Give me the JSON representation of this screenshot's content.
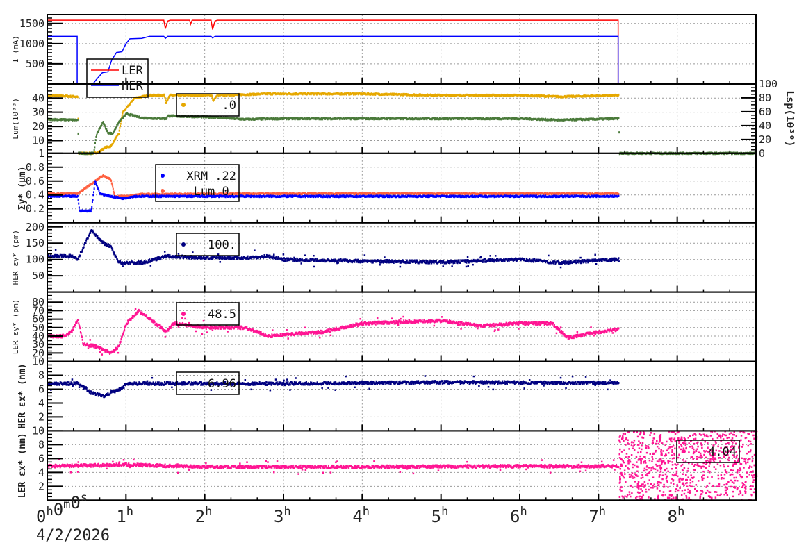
{
  "chart_data": {
    "type": "scatter",
    "title": "",
    "xlabel": "",
    "date": "4/2/2026",
    "xlim": [
      0,
      9
    ],
    "x_units": "hours",
    "x_ticks": [
      {
        "v": 0,
        "parts": [
          [
            "0",
            "h"
          ],
          [
            "0",
            "m"
          ],
          [
            "0",
            "s"
          ]
        ]
      },
      {
        "v": 1,
        "parts": [
          [
            "1",
            "h"
          ]
        ]
      },
      {
        "v": 2,
        "parts": [
          [
            "2",
            "h"
          ]
        ]
      },
      {
        "v": 3,
        "parts": [
          [
            "3",
            "h"
          ]
        ]
      },
      {
        "v": 4,
        "parts": [
          [
            "4",
            "h"
          ]
        ]
      },
      {
        "v": 5,
        "parts": [
          [
            "5",
            "h"
          ]
        ]
      },
      {
        "v": 6,
        "parts": [
          [
            "6",
            "h"
          ]
        ]
      },
      {
        "v": 7,
        "parts": [
          [
            "7",
            "h"
          ]
        ]
      },
      {
        "v": 8,
        "parts": [
          [
            "8",
            "h"
          ]
        ]
      }
    ],
    "grid": true,
    "panels": [
      {
        "ylabel": "I (mA)",
        "bold": false,
        "ylim": [
          0,
          1720
        ],
        "yticks": [
          500,
          1000,
          1500
        ],
        "legend": [
          {
            "label": "LER",
            "color": "#ff0000",
            "marker": "line"
          },
          {
            "label": "HER",
            "color": "#0000ff",
            "marker": "line"
          }
        ],
        "series": [
          {
            "name": "LER",
            "color": "#ff0000",
            "style": "line",
            "points": [
              [
                0,
                1580
              ],
              [
                1.48,
                1580
              ],
              [
                1.5,
                1370
              ],
              [
                1.53,
                1560
              ],
              [
                1.56,
                1580
              ],
              [
                1.81,
                1580
              ],
              [
                1.82,
                1480
              ],
              [
                1.84,
                1580
              ],
              [
                2.08,
                1580
              ],
              [
                2.1,
                1350
              ],
              [
                2.13,
                1560
              ],
              [
                2.16,
                1580
              ],
              [
                7.25,
                1580
              ],
              [
                7.25,
                0
              ]
            ]
          },
          {
            "name": "HER",
            "color": "#0000ff",
            "style": "line",
            "points": [
              [
                0,
                1180
              ],
              [
                0.38,
                1180
              ],
              [
                0.38,
                0
              ],
              [
                0.58,
                0
              ],
              [
                0.62,
                100
              ],
              [
                0.7,
                280
              ],
              [
                0.77,
                300
              ],
              [
                0.82,
                600
              ],
              [
                0.88,
                780
              ],
              [
                0.95,
                800
              ],
              [
                1.0,
                1000
              ],
              [
                1.05,
                1120
              ],
              [
                1.2,
                1130
              ],
              [
                1.3,
                1180
              ],
              [
                1.48,
                1180
              ],
              [
                1.5,
                1130
              ],
              [
                1.53,
                1180
              ],
              [
                2.08,
                1180
              ],
              [
                2.1,
                1140
              ],
              [
                2.13,
                1180
              ],
              [
                7.25,
                1180
              ],
              [
                7.25,
                0
              ]
            ]
          }
        ]
      },
      {
        "ylabel": "Lum(10³³)",
        "bold": false,
        "ylim": [
          1,
          50
        ],
        "yticks": [
          1,
          10,
          20,
          30,
          40
        ],
        "right_axis": {
          "label": "Lsp(10³⁰)",
          "ylim": [
            0,
            100
          ],
          "yticks": [
            0,
            20,
            40,
            60,
            80,
            100
          ]
        },
        "legend": [
          {
            "label": ".0",
            "color": "#e6a800",
            "marker": "dot"
          }
        ],
        "series": [
          {
            "name": "Lum",
            "color": "#e6a800",
            "style": "band",
            "points": [
              [
                0,
                42
              ],
              [
                0.38,
                41
              ],
              [
                0.39,
                1
              ],
              [
                0.58,
                1
              ],
              [
                0.65,
                2
              ],
              [
                0.72,
                5
              ],
              [
                0.8,
                6
              ],
              [
                0.9,
                15
              ],
              [
                0.95,
                30
              ],
              [
                1.0,
                33
              ],
              [
                1.1,
                40
              ],
              [
                1.3,
                42
              ],
              [
                1.48,
                42
              ],
              [
                1.5,
                37
              ],
              [
                1.55,
                42
              ],
              [
                2.08,
                42
              ],
              [
                2.1,
                38
              ],
              [
                2.15,
                42
              ],
              [
                2.8,
                43
              ],
              [
                4,
                43
              ],
              [
                5,
                42
              ],
              [
                6,
                42
              ],
              [
                6.5,
                41
              ],
              [
                7.25,
                42
              ]
            ]
          },
          {
            "name": "Lsp",
            "color": "#4a7a3a",
            "style": "band",
            "axis": "right",
            "points": [
              [
                0,
                49
              ],
              [
                0.38,
                48
              ],
              [
                0.39,
                0
              ],
              [
                0.58,
                0
              ],
              [
                0.62,
                28
              ],
              [
                0.7,
                45
              ],
              [
                0.76,
                30
              ],
              [
                0.82,
                28
              ],
              [
                0.9,
                45
              ],
              [
                1.0,
                57
              ],
              [
                1.2,
                51
              ],
              [
                1.5,
                50
              ],
              [
                1.52,
                54
              ],
              [
                2.1,
                52
              ],
              [
                2.5,
                49
              ],
              [
                3,
                50
              ],
              [
                4,
                50
              ],
              [
                5,
                50
              ],
              [
                6,
                50
              ],
              [
                6.5,
                48
              ],
              [
                7.25,
                50
              ],
              [
                7.26,
                0
              ],
              [
                9,
                0
              ]
            ]
          }
        ]
      },
      {
        "ylabel": "Σy* (μm)",
        "bold": true,
        "ylim": [
          0,
          1
        ],
        "yticks": [
          0.2,
          0.4,
          0.6,
          0.8
        ],
        "legend": [
          {
            "label": "XRM  .22",
            "color": "#0000ff",
            "marker": "dot"
          },
          {
            "label": "Lum 0.",
            "color": "#ff6040",
            "marker": "dot"
          }
        ],
        "series": [
          {
            "name": "Lum",
            "color": "#ff6040",
            "style": "band",
            "points": [
              [
                0,
                0.42
              ],
              [
                0.38,
                0.42
              ],
              [
                0.6,
                0.6
              ],
              [
                0.7,
                0.68
              ],
              [
                0.8,
                0.62
              ],
              [
                0.85,
                0.38
              ],
              [
                1.0,
                0.38
              ],
              [
                1.2,
                0.41
              ],
              [
                3,
                0.42
              ],
              [
                5,
                0.42
              ],
              [
                7.25,
                0.42
              ]
            ]
          },
          {
            "name": "XRM",
            "color": "#0000ff",
            "style": "band",
            "points": [
              [
                0,
                0.38
              ],
              [
                0.38,
                0.38
              ],
              [
                0.4,
                0.17
              ],
              [
                0.55,
                0.17
              ],
              [
                0.6,
                0.6
              ],
              [
                0.66,
                0.42
              ],
              [
                0.8,
                0.38
              ],
              [
                0.95,
                0.35
              ],
              [
                1.1,
                0.38
              ],
              [
                3,
                0.38
              ],
              [
                5,
                0.38
              ],
              [
                7.25,
                0.38
              ]
            ]
          }
        ]
      },
      {
        "ylabel": "HER εy* (pm)",
        "bold": false,
        "ylim": [
          0,
          213
        ],
        "yticks": [
          50,
          100,
          150,
          200
        ],
        "legend": [
          {
            "label": "100.",
            "color": "#000080",
            "marker": "dot"
          }
        ],
        "series": [
          {
            "name": "HER εy",
            "color": "#000080",
            "style": "band",
            "points": [
              [
                0,
                110
              ],
              [
                0.3,
                110
              ],
              [
                0.38,
                100
              ],
              [
                0.55,
                190
              ],
              [
                0.7,
                150
              ],
              [
                0.8,
                140
              ],
              [
                0.9,
                90
              ],
              [
                1.2,
                90
              ],
              [
                1.5,
                110
              ],
              [
                2,
                105
              ],
              [
                2.5,
                105
              ],
              [
                2.8,
                110
              ],
              [
                3,
                100
              ],
              [
                4,
                95
              ],
              [
                5,
                92
              ],
              [
                6,
                100
              ],
              [
                6.5,
                90
              ],
              [
                7.25,
                100
              ]
            ]
          }
        ]
      },
      {
        "ylabel": "LER εy* (pm)",
        "bold": false,
        "ylim": [
          10,
          92
        ],
        "yticks": [
          10,
          20,
          30,
          40,
          50,
          60,
          70,
          80
        ],
        "legend": [
          {
            "label": "48.5",
            "color": "#ff1493",
            "marker": "dot"
          }
        ],
        "series": [
          {
            "name": "LER εy",
            "color": "#ff1493",
            "style": "band",
            "points": [
              [
                0,
                40
              ],
              [
                0.2,
                40
              ],
              [
                0.3,
                45
              ],
              [
                0.38,
                60
              ],
              [
                0.45,
                30
              ],
              [
                0.6,
                28
              ],
              [
                0.8,
                20
              ],
              [
                0.9,
                28
              ],
              [
                1.0,
                55
              ],
              [
                1.15,
                70
              ],
              [
                1.3,
                60
              ],
              [
                1.5,
                45
              ],
              [
                1.6,
                55
              ],
              [
                2,
                50
              ],
              [
                2.5,
                50
              ],
              [
                2.8,
                40
              ],
              [
                3.5,
                45
              ],
              [
                4,
                55
              ],
              [
                5,
                58
              ],
              [
                5.5,
                52
              ],
              [
                6,
                55
              ],
              [
                6.4,
                55
              ],
              [
                6.6,
                38
              ],
              [
                7,
                45
              ],
              [
                7.25,
                48
              ]
            ]
          }
        ]
      },
      {
        "ylabel": "HER εx* (nm)",
        "bold": true,
        "ylim": [
          0,
          10
        ],
        "yticks": [
          2,
          4,
          6,
          8
        ],
        "legend": [
          {
            "label": "6.96",
            "color": "#000080",
            "marker": "dot"
          }
        ],
        "series": [
          {
            "name": "HER εx",
            "color": "#000080",
            "style": "band",
            "points": [
              [
                0,
                6.8
              ],
              [
                0.38,
                6.8
              ],
              [
                0.55,
                5.5
              ],
              [
                0.7,
                5
              ],
              [
                0.8,
                5.5
              ],
              [
                0.95,
                6.2
              ],
              [
                1.0,
                6.8
              ],
              [
                3,
                6.8
              ],
              [
                5,
                7.0
              ],
              [
                7.25,
                6.9
              ]
            ]
          }
        ]
      },
      {
        "ylabel": "LER εx* (nm)",
        "bold": true,
        "ylim": [
          0,
          10
        ],
        "yticks": [
          2,
          4,
          6,
          8,
          10
        ],
        "legend": [
          {
            "label": "4.04",
            "color": "#ff1493",
            "marker": "dot"
          }
        ],
        "series": [
          {
            "name": "LER εx",
            "color": "#ff1493",
            "style": "band",
            "points": [
              [
                0,
                4.9
              ],
              [
                1,
                5.1
              ],
              [
                2,
                4.8
              ],
              [
                4,
                4.8
              ],
              [
                6,
                4.9
              ],
              [
                7.25,
                4.9
              ]
            ]
          },
          {
            "name": "LER εx noise",
            "color": "#ff1493",
            "style": "noise",
            "points": [
              [
                7.25,
                0
              ],
              [
                9,
                10
              ]
            ]
          }
        ]
      }
    ]
  }
}
